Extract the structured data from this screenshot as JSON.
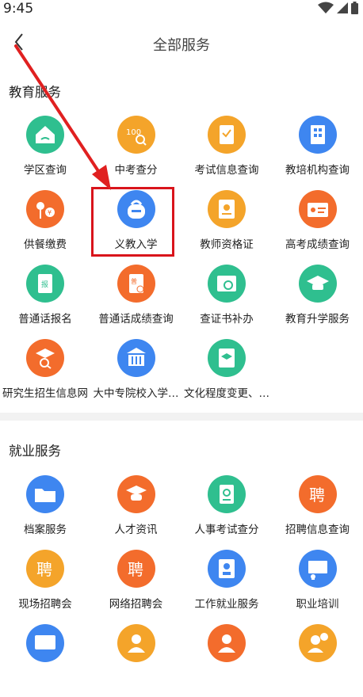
{
  "status": {
    "time": "9:45"
  },
  "header": {
    "title": "全部服务"
  },
  "sections": {
    "education": {
      "title": "教育服务",
      "items": [
        {
          "label": "学区查询",
          "icon": "house-icon",
          "color": "#2fbf8f"
        },
        {
          "label": "中考查分",
          "icon": "score-search-icon",
          "color": "#f4a42a"
        },
        {
          "label": "考试信息查询",
          "icon": "exam-clipboard-icon",
          "color": "#f4a42a"
        },
        {
          "label": "教培机构查询",
          "icon": "building-icon",
          "color": "#3e86f0"
        },
        {
          "label": "供餐缴费",
          "icon": "meal-payment-icon",
          "color": "#f36c2c"
        },
        {
          "label": "义教入学",
          "icon": "school-bag-icon",
          "color": "#3e86f0"
        },
        {
          "label": "教师资格证",
          "icon": "certificate-icon",
          "color": "#f4a42a"
        },
        {
          "label": "高考成绩查询",
          "icon": "id-card-icon",
          "color": "#f36c2c"
        },
        {
          "label": "普通话报名",
          "icon": "book-register-icon",
          "color": "#2fbf8f"
        },
        {
          "label": "普通话成绩查询",
          "icon": "book-score-icon",
          "color": "#f36c2c"
        },
        {
          "label": "查证书补办",
          "icon": "certificate-reissue-icon",
          "color": "#2fbf8f"
        },
        {
          "label": "教育升学服务",
          "icon": "graduation-cap-icon",
          "color": "#2fbf8f"
        },
        {
          "label": "研究生招生信息网",
          "icon": "graduate-search-icon",
          "color": "#f36c2c"
        },
        {
          "label": "大中专院校入学…",
          "icon": "college-icon",
          "color": "#3e86f0"
        },
        {
          "label": "文化程度变更、…",
          "icon": "education-change-icon",
          "color": "#2fbf8f"
        }
      ]
    },
    "employment": {
      "title": "就业服务",
      "items": [
        {
          "label": "档案服务",
          "icon": "folder-icon",
          "color": "#3e86f0"
        },
        {
          "label": "人才资讯",
          "icon": "talent-cap-icon",
          "color": "#f36c2c"
        },
        {
          "label": "人事考试查分",
          "icon": "document-search-icon",
          "color": "#2fbf8f"
        },
        {
          "label": "招聘信息查询",
          "icon": "recruit-icon",
          "color": "#f36c2c"
        },
        {
          "label": "现场招聘会",
          "icon": "recruit-icon",
          "color": "#f4a42a"
        },
        {
          "label": "网络招聘会",
          "icon": "recruit-icon",
          "color": "#f36c2c"
        },
        {
          "label": "工作就业服务",
          "icon": "employee-card-icon",
          "color": "#3e86f0"
        },
        {
          "label": "职业培训",
          "icon": "training-board-icon",
          "color": "#3e86f0"
        },
        {
          "label": "",
          "icon": "screen-icon",
          "color": "#3e86f0"
        },
        {
          "label": "",
          "icon": "person-icon",
          "color": "#f4a42a"
        },
        {
          "label": "",
          "icon": "person-icon",
          "color": "#f36c2c"
        },
        {
          "label": "",
          "icon": "person-money-icon",
          "color": "#f4a42a"
        }
      ]
    }
  }
}
